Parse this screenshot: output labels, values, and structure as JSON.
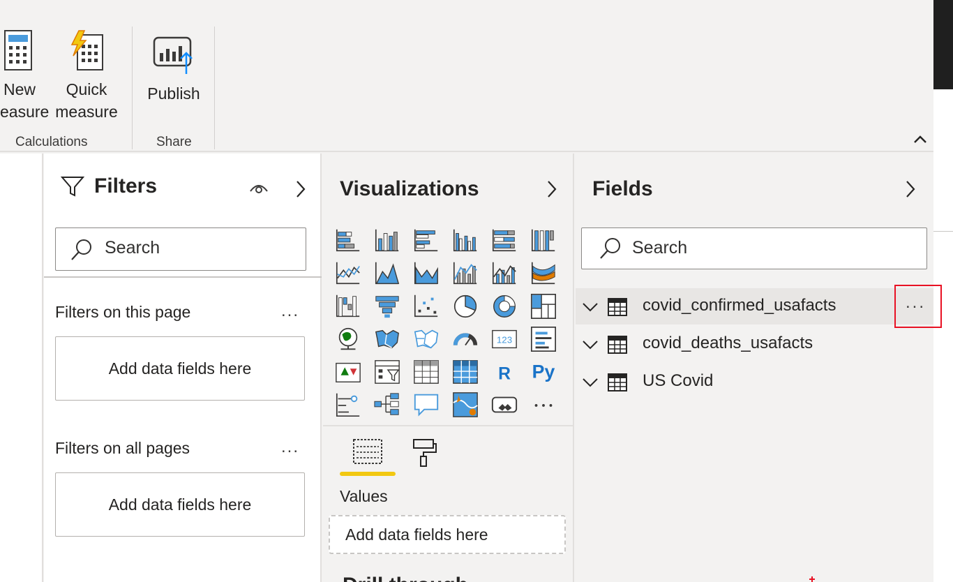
{
  "ribbon": {
    "new_measure_line1": "New",
    "new_measure_line2": "easure",
    "quick_measure_line1": "Quick",
    "quick_measure_line2": "measure",
    "publish_label": "Publish",
    "group_calculations": "Calculations",
    "group_share": "Share"
  },
  "filters": {
    "title": "Filters",
    "search_placeholder": "Search",
    "section_page": "Filters on this page",
    "section_all": "Filters on all pages",
    "drop_label": "Add data fields here",
    "more": "..."
  },
  "visualizations": {
    "title": "Visualizations",
    "icons": [
      "stacked-bar-chart-icon",
      "stacked-column-chart-icon",
      "clustered-bar-chart-icon",
      "clustered-column-chart-icon",
      "100-stacked-bar-chart-icon",
      "100-stacked-column-chart-icon",
      "line-chart-icon",
      "area-chart-icon",
      "stacked-area-chart-icon",
      "line-clustered-column-icon",
      "line-stacked-column-icon",
      "ribbon-chart-icon",
      "waterfall-chart-icon",
      "funnel-chart-icon",
      "scatter-chart-icon",
      "pie-chart-icon",
      "donut-chart-icon",
      "treemap-icon",
      "map-icon",
      "filled-map-icon",
      "shape-map-icon",
      "gauge-icon",
      "card-icon",
      "multi-row-card-icon",
      "kpi-icon",
      "slicer-icon",
      "table-icon",
      "matrix-icon",
      "r-visual-icon",
      "python-visual-icon",
      "key-influencers-icon",
      "decomposition-tree-icon",
      "qa-icon",
      "arcgis-map-icon",
      "power-apps-icon",
      "more-visuals-icon"
    ],
    "r_glyph": "R",
    "py_glyph": "Py",
    "more_glyph": "...",
    "values_label": "Values",
    "values_drop": "Add data fields here",
    "drill_title": "Drill through"
  },
  "fields": {
    "title": "Fields",
    "search_placeholder": "Search",
    "tables": [
      {
        "name": "covid_confirmed_usafacts"
      },
      {
        "name": "covid_deaths_usafacts"
      },
      {
        "name": "US Covid"
      }
    ],
    "more": "..."
  },
  "colors": {
    "accent_blue": "#118dff",
    "icon_blue": "#4a9bdc",
    "highlight_yellow": "#f2c811",
    "callout_red": "#e81123"
  }
}
